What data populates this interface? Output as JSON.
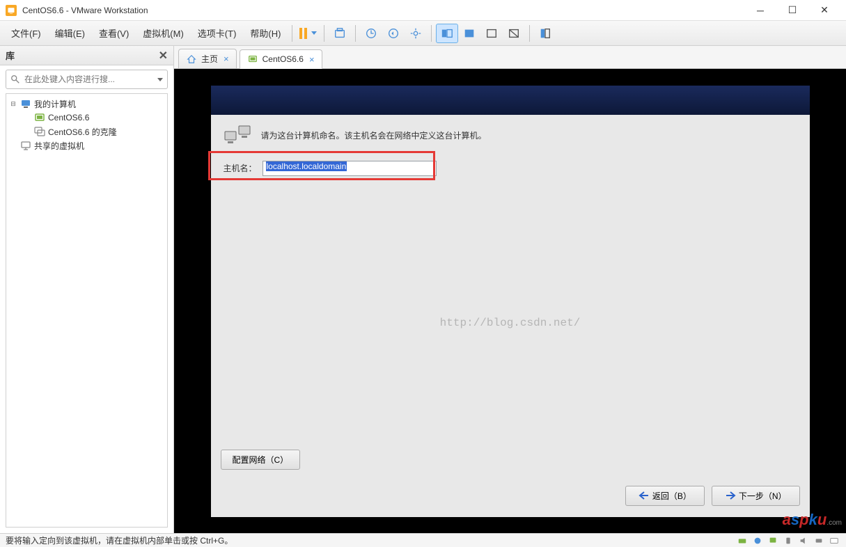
{
  "window": {
    "title": "CentOS6.6 - VMware Workstation"
  },
  "menu": {
    "file": "文件(F)",
    "edit": "编辑(E)",
    "view": "查看(V)",
    "vm": "虚拟机(M)",
    "tabs": "选项卡(T)",
    "help": "帮助(H)"
  },
  "library": {
    "title": "库",
    "search_placeholder": "在此处键入内容进行搜...",
    "tree": {
      "my_computer": "我的计算机",
      "centos66": "CentOS6.6",
      "centos66_clone": "CentOS6.6 的克隆",
      "shared_vms": "共享的虚拟机"
    }
  },
  "tabs": {
    "home": "主页",
    "centos66": "CentOS6.6"
  },
  "installer": {
    "message": "请为这台计算机命名。该主机名会在网络中定义这台计算机。",
    "hostname_label": "主机名：",
    "hostname_value": "localhost.localdomain",
    "config_network": "配置网络（C）",
    "back": "返回（B）",
    "next": "下一步（N）"
  },
  "watermark": "http://blog.csdn.net/",
  "statusbar": {
    "message": "要将输入定向到该虚拟机，请在虚拟机内部单击或按 Ctrl+G。"
  }
}
